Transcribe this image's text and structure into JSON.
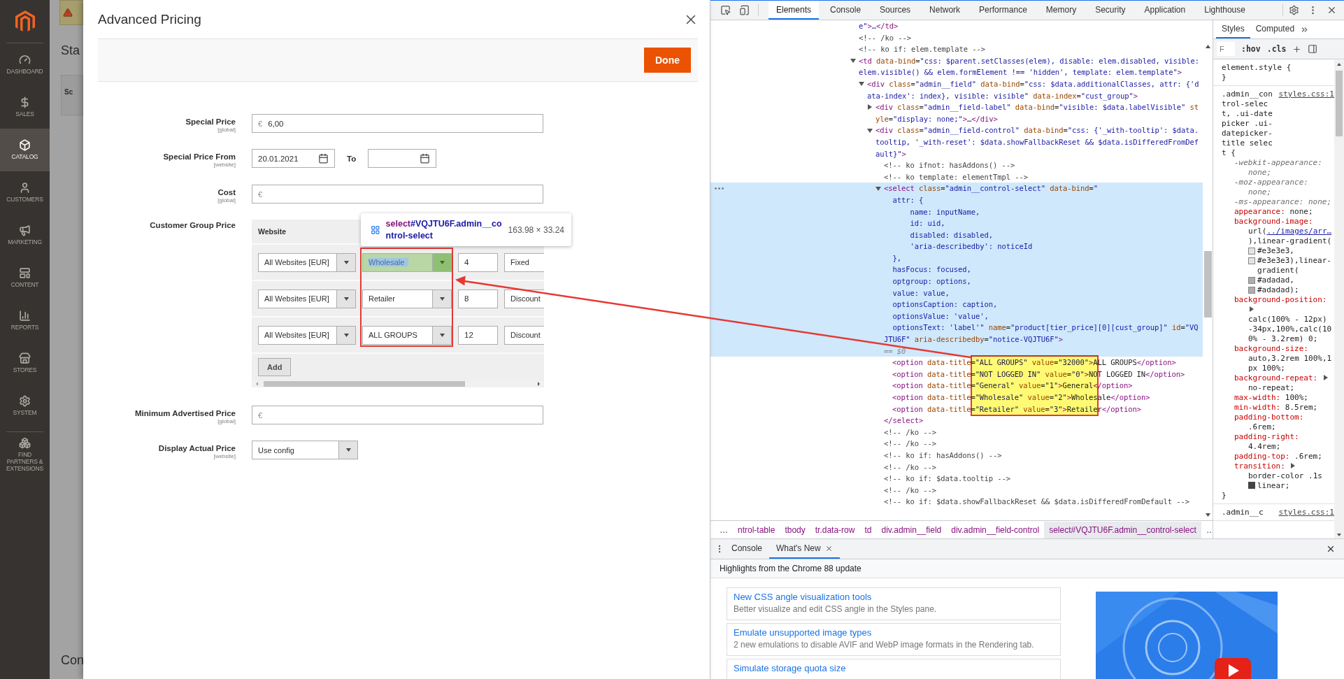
{
  "admin_sidebar": {
    "items": [
      {
        "label": "DASHBOARD",
        "selected": false
      },
      {
        "label": "SALES",
        "selected": false
      },
      {
        "label": "CATALOG",
        "selected": true
      },
      {
        "label": "CUSTOMERS",
        "selected": false
      },
      {
        "label": "MARKETING",
        "selected": false
      },
      {
        "label": "CONTENT",
        "selected": false
      },
      {
        "label": "REPORTS",
        "selected": false
      },
      {
        "label": "STORES",
        "selected": false
      },
      {
        "label": "SYSTEM",
        "selected": false
      },
      {
        "label": "FIND PARTNERS & EXTENSIONS",
        "selected": false
      }
    ]
  },
  "background_page": {
    "heading": "Sta",
    "card_text": "Sc",
    "footer_text": "Con"
  },
  "modal": {
    "title": "Advanced Pricing",
    "done_button": "Done",
    "fields": [
      {
        "kind": "price",
        "label": "Special Price",
        "scope": "[global]",
        "currency": "€",
        "value": "6,00"
      },
      {
        "kind": "date_range",
        "label": "Special Price From",
        "scope": "[website]",
        "from": "20.01.2021",
        "to_label": "To"
      },
      {
        "kind": "price",
        "label": "Cost",
        "scope": "[global]",
        "currency": "€"
      },
      {
        "kind": "tier_grid",
        "label": "Customer Group Price",
        "columns": [
          "Website"
        ],
        "add_button": "Add",
        "rows": [
          {
            "website": "All Websites [EUR]",
            "group": "Wholesale",
            "inspected": true,
            "qty": "4",
            "price_type": "Fixed"
          },
          {
            "website": "All Websites [EUR]",
            "group": "Retailer",
            "inspected": false,
            "qty": "8",
            "price_type": "Discount"
          },
          {
            "website": "All Websites [EUR]",
            "group": "ALL GROUPS",
            "inspected": false,
            "qty": "12",
            "price_type": "Discount"
          }
        ]
      },
      {
        "kind": "price",
        "label": "Minimum Advertised Price",
        "scope": "[global]",
        "currency": "€"
      },
      {
        "kind": "select",
        "label": "Display Actual Price",
        "scope": "[website]",
        "value": "Use config"
      }
    ]
  },
  "inspect_tooltip": {
    "tag": "select",
    "selector": "#VQJTU6F.admin__control-select",
    "size": "163.98 × 33.24"
  },
  "devtools": {
    "tabs": [
      {
        "label": "Elements",
        "selected": true
      },
      {
        "label": "Console",
        "selected": false
      },
      {
        "label": "Sources",
        "selected": false
      },
      {
        "label": "Network",
        "selected": false
      },
      {
        "label": "Performance",
        "selected": false
      },
      {
        "label": "Memory",
        "selected": false
      },
      {
        "label": "Security",
        "selected": false
      },
      {
        "label": "Application",
        "selected": false
      },
      {
        "label": "Lighthouse",
        "selected": false
      }
    ],
    "dom_tree": [
      {
        "kind": "fragment",
        "text": "e\">…</td>",
        "selected": false
      },
      {
        "kind": "comment",
        "text": "<!-- /ko -->",
        "selected": false
      },
      {
        "kind": "comment",
        "text": "<!-- ko if: elem.template -->",
        "selected": false
      },
      {
        "kind": "element",
        "text": "<td data-bind=\"css: $parent.setClasses(elem), disable: elem.disabled, visible: elem.visible() && elem.formElement !== 'hidden', template: elem.template\">",
        "expanded": true,
        "selected": false,
        "children": [
          {
            "kind": "element",
            "text": "<div class=\"admin__field\" data-bind=\"css: $data.additionalClasses, attr: {'data-index': index}, visible: visible\" data-index=\"cust_group\">",
            "expanded": true,
            "selected": false,
            "children": [
              {
                "kind": "element",
                "text": "<div class=\"admin__field-label\" data-bind=\"visible: $data.labelVisible\" style=\"display: none;\">…</div>",
                "expanded": false,
                "selected": false
              },
              {
                "kind": "element",
                "text": "<div class=\"admin__field-control\" data-bind=\"css: {'_with-tooltip': $data.tooltip, '_with-reset': $data.showFallbackReset && $data.isDifferedFromDefault}\">",
                "expanded": true,
                "selected": false,
                "children": [
                  {
                    "kind": "comment",
                    "text": "<!-- ko ifnot: hasAddons() -->",
                    "selected": false
                  },
                  {
                    "kind": "comment",
                    "text": "<!-- ko template: elementTmpl -->",
                    "selected": false
                  },
                  {
                    "kind": "element",
                    "text": "<select class=\"admin__control-select\" data-bind=\"\n  attr: {\n      name: inputName,\n      id: uid,\n      disabled: disabled,\n      'aria-describedby': noticeId\n  },\n  hasFocus: focused,\n  optgroup: options,\n  value: value,\n  optionsCaption: caption,\n  optionsValue: 'value',\n  optionsText: 'label'\" name=\"product[tier_price][0][cust_group]\" id=\"VQJTU6F\" aria-describedby=\"notice-VQJTU6F\">",
                    "console_ref": "== $0",
                    "expanded": true,
                    "selected": true,
                    "callout": true,
                    "closing": "</select>",
                    "children": [
                      {
                        "kind": "element",
                        "text": "<option data-title=\"ALL GROUPS\" value=\"32000\">ALL GROUPS</option>",
                        "selected": false
                      },
                      {
                        "kind": "element",
                        "text": "<option data-title=\"NOT LOGGED IN\" value=\"0\">NOT LOGGED IN</option>",
                        "selected": false
                      },
                      {
                        "kind": "element",
                        "text": "<option data-title=\"General\" value=\"1\">General</option>",
                        "selected": false
                      },
                      {
                        "kind": "element",
                        "text": "<option data-title=\"Wholesale\" value=\"2\">Wholesale</option>",
                        "selected": false
                      },
                      {
                        "kind": "element",
                        "text": "<option data-title=\"Retailer\" value=\"3\">Retailer</option>",
                        "selected": false
                      }
                    ]
                  },
                  {
                    "kind": "comment",
                    "text": "<!-- /ko -->",
                    "selected": false
                  },
                  {
                    "kind": "comment",
                    "text": "<!-- /ko -->",
                    "selected": false
                  },
                  {
                    "kind": "comment",
                    "text": "<!-- ko if: hasAddons() -->",
                    "selected": false
                  },
                  {
                    "kind": "comment",
                    "text": "<!-- /ko -->",
                    "selected": false
                  },
                  {
                    "kind": "comment",
                    "text": "<!-- ko if: $data.tooltip -->",
                    "selected": false
                  },
                  {
                    "kind": "comment",
                    "text": "<!-- /ko -->",
                    "selected": false
                  },
                  {
                    "kind": "comment",
                    "text": "<!-- ko if: $data.showFallbackReset && $data.isDifferedFromDefault -->",
                    "selected": false
                  }
                ]
              }
            ]
          }
        ]
      }
    ],
    "breadcrumbs": [
      {
        "kind": "more",
        "label": "…",
        "selected": false
      },
      {
        "kind": "crumb",
        "label": "ntrol-table",
        "selected": false
      },
      {
        "kind": "crumb",
        "label": "tbody",
        "selected": false
      },
      {
        "kind": "crumb",
        "label": "tr.data-row",
        "selected": false
      },
      {
        "kind": "crumb",
        "label": "td",
        "selected": false
      },
      {
        "kind": "crumb",
        "label": "div.admin__field",
        "selected": false
      },
      {
        "kind": "crumb",
        "label": "div.admin__field-control",
        "selected": false
      },
      {
        "kind": "crumb",
        "label": "select#VQJTU6F.admin__control-select",
        "selected": true
      },
      {
        "kind": "more",
        "label": "…",
        "selected": false
      }
    ],
    "styles_pane": {
      "tabs": [
        {
          "label": "Styles",
          "selected": true
        },
        {
          "label": "Computed",
          "selected": false
        }
      ],
      "filter_placeholder": "F",
      "hov": ":hov",
      "cls": ".cls",
      "rules": [
        {
          "selector": "element.style {",
          "closing": "}"
        },
        {
          "selector": ".admin__control-select, .ui-datepicker .ui-datepicker-title select {",
          "source": "styles.css:1",
          "closing": "}",
          "properties": [
            {
              "name": "-webkit-appearance:",
              "overridden": true,
              "expandable": false,
              "value": [
                {
                  "kind": "text",
                  "text": "none;"
                }
              ]
            },
            {
              "name": "-moz-appearance:",
              "overridden": true,
              "expandable": false,
              "value": [
                {
                  "kind": "text",
                  "text": "none;"
                }
              ]
            },
            {
              "name": "-ms-appearance:",
              "overridden": true,
              "expandable": false,
              "value": [
                {
                  "kind": "text",
                  "text": "none;"
                }
              ]
            },
            {
              "name": "appearance:",
              "overridden": false,
              "expandable": false,
              "value": [
                {
                  "kind": "text",
                  "text": "none;"
                }
              ]
            },
            {
              "name": "background-image:",
              "overridden": false,
              "expandable": false,
              "value": [
                {
                  "kind": "text",
                  "text": "url("
                },
                {
                  "kind": "link",
                  "text": "../images/arr…"
                },
                {
                  "kind": "text",
                  "text": "),linear-gradient("
                },
                {
                  "kind": "swatch",
                  "color": "#e3e3e3",
                  "text": "#e3e3e3,"
                },
                {
                  "kind": "swatch",
                  "color": "#e3e3e3",
                  "text": "#e3e3e3),linear-gradient("
                },
                {
                  "kind": "swatch",
                  "color": "#adadad",
                  "text": "#adadad,"
                },
                {
                  "kind": "swatch",
                  "color": "#adadad",
                  "text": "#adadad);"
                }
              ]
            },
            {
              "name": "background-position:",
              "overridden": false,
              "expandable": true,
              "value": [
                {
                  "kind": "text",
                  "text": "calc(100% - 12px) -34px,100%,calc(100% - 3.2rem) 0;"
                }
              ]
            },
            {
              "name": "background-size:",
              "overridden": false,
              "expandable": false,
              "value": [
                {
                  "kind": "text",
                  "text": "auto,3.2rem 100%,1px 100%;"
                }
              ]
            },
            {
              "name": "background-repeat:",
              "overridden": false,
              "expandable": true,
              "value": [
                {
                  "kind": "text",
                  "text": "no-repeat;"
                }
              ]
            },
            {
              "name": "max-width:",
              "overridden": false,
              "expandable": false,
              "value": [
                {
                  "kind": "text",
                  "text": "100%;"
                }
              ]
            },
            {
              "name": "min-width:",
              "overridden": false,
              "expandable": false,
              "value": [
                {
                  "kind": "text",
                  "text": "8.5rem;"
                }
              ]
            },
            {
              "name": "padding-bottom:",
              "overridden": false,
              "expandable": false,
              "value": [
                {
                  "kind": "text",
                  "text": ".6rem;"
                }
              ]
            },
            {
              "name": "padding-right:",
              "overridden": false,
              "expandable": false,
              "value": [
                {
                  "kind": "text",
                  "text": "4.4rem;"
                }
              ]
            },
            {
              "name": "padding-top:",
              "overridden": false,
              "expandable": false,
              "value": [
                {
                  "kind": "text",
                  "text": ".6rem;"
                }
              ]
            },
            {
              "name": "transition:",
              "overridden": false,
              "expandable": true,
              "value": [
                {
                  "kind": "text",
                  "text": "border-color .1s"
                },
                {
                  "kind": "easing",
                  "text": "linear;"
                }
              ]
            }
          ]
        },
        {
          "selector": ".admin__c",
          "source": "styles.css:1"
        }
      ]
    },
    "drawer": {
      "tabs": [
        {
          "label": "Console",
          "selected": false,
          "closable": false
        },
        {
          "label": "What's New",
          "selected": true,
          "closable": true
        }
      ],
      "heading": "Highlights from the Chrome 88 update",
      "cards": [
        {
          "title": "New CSS angle visualization tools",
          "description": "Better visualize and edit CSS angle in the Styles pane."
        },
        {
          "title": "Emulate unsupported image types",
          "description": "2 new emulations to disable AVIF and WebP image formats in the Rendering tab."
        },
        {
          "title": "Simulate storage quota size"
        }
      ]
    }
  }
}
